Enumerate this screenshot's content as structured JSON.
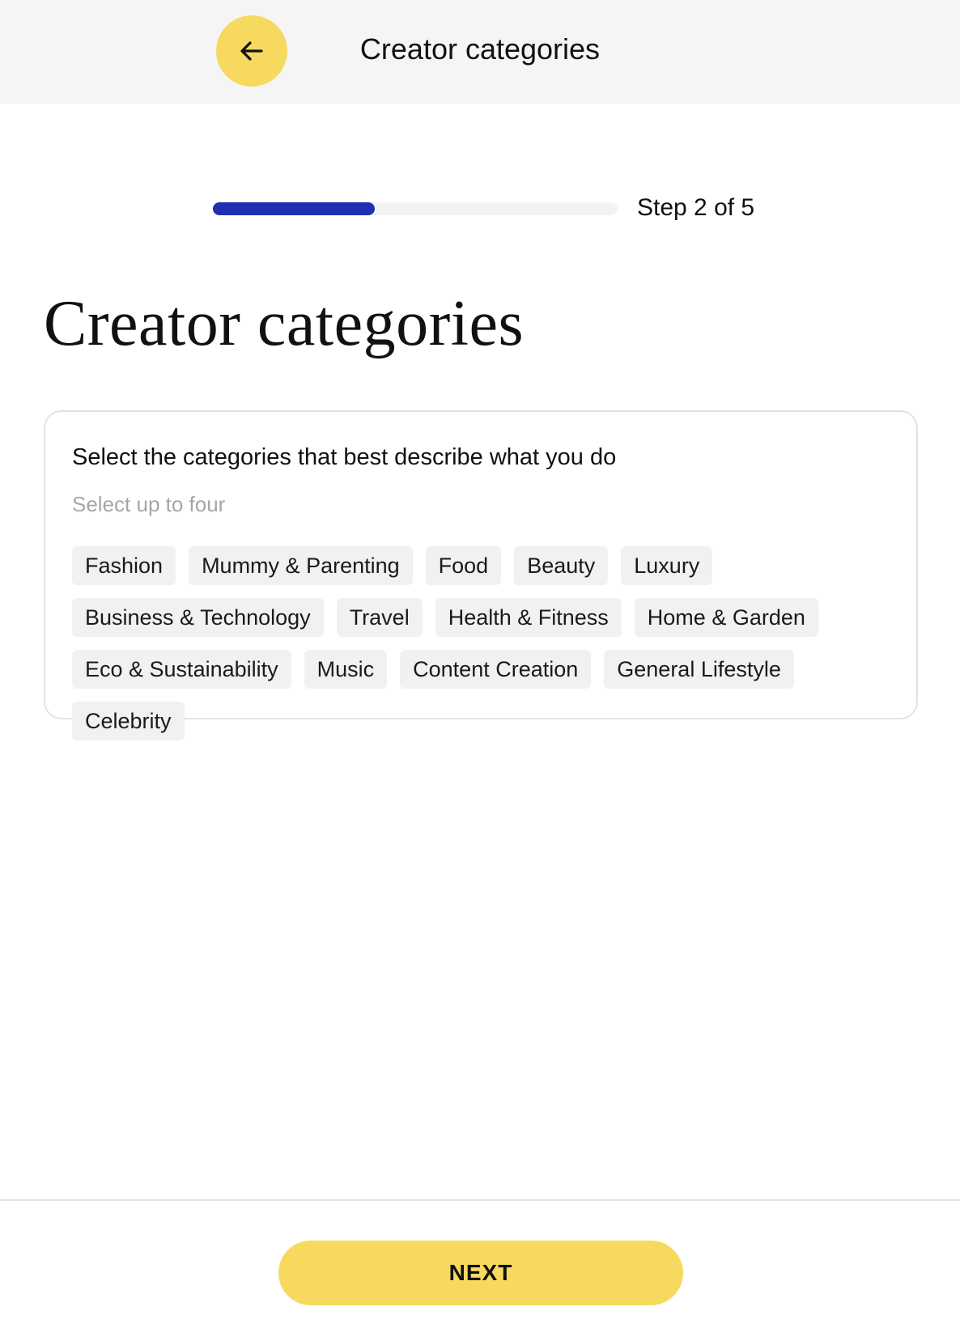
{
  "header": {
    "back_icon": "arrow-left-icon",
    "title": "Creator categories",
    "accent_color": "#f7d95f"
  },
  "progress": {
    "step_text": "Step 2 of 5",
    "fraction": 0.4,
    "color": "#1f2fb0"
  },
  "page": {
    "title": "Creator categories"
  },
  "categories_card": {
    "heading": "Select the categories that best describe what you do",
    "subtext": "Select up to four",
    "options": [
      "Fashion",
      "Mummy & Parenting",
      "Food",
      "Beauty",
      "Luxury",
      "Business & Technology",
      "Travel",
      "Health & Fitness",
      "Home & Garden",
      "Eco & Sustainability",
      "Music",
      "Content Creation",
      "General Lifestyle",
      "Celebrity"
    ]
  },
  "footer": {
    "next_label": "NEXT"
  }
}
